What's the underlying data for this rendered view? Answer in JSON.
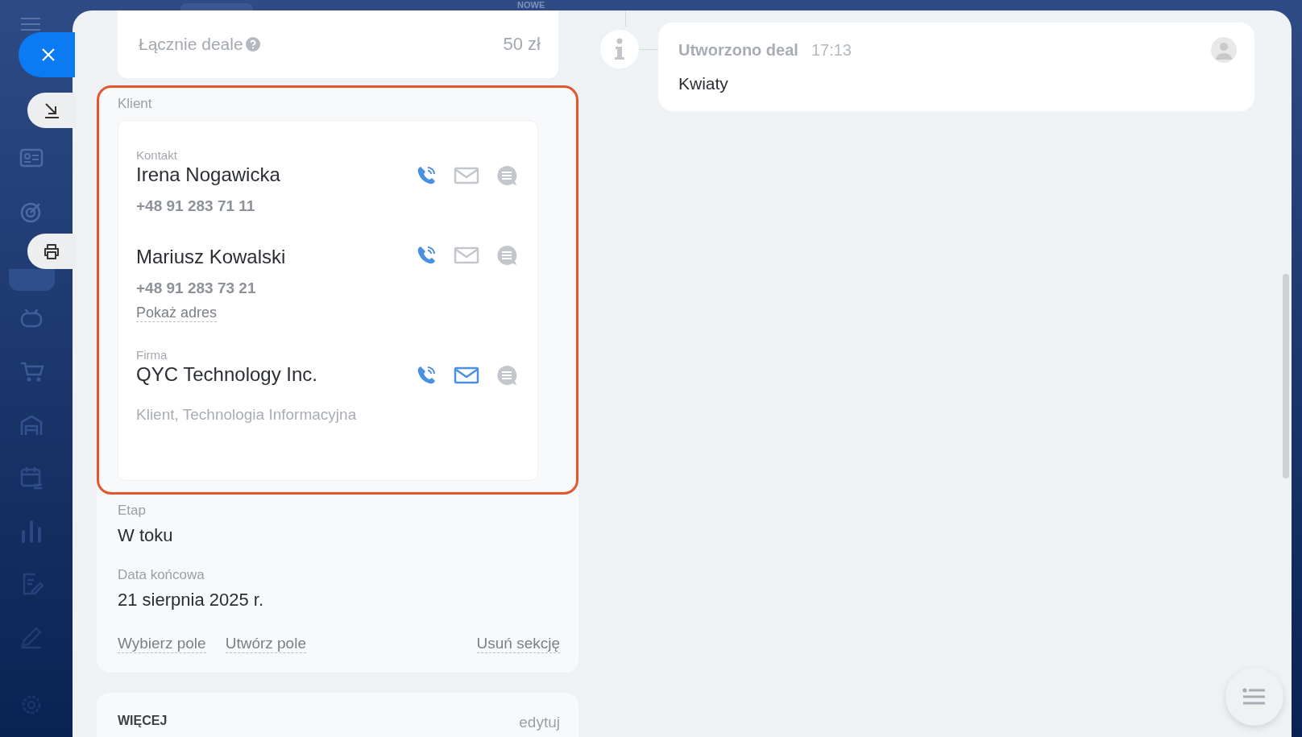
{
  "top_badge": "NOWE",
  "summary": {
    "label": "Łącznie deale",
    "value": "50 zł"
  },
  "client": {
    "title": "Klient",
    "highlighted": true,
    "contacts": [
      {
        "caption": "Kontakt",
        "name": "Irena Nogawicka",
        "phone": "+48 91 283 71 11",
        "email_active": false
      },
      {
        "name": "Mariusz Kowalski",
        "phone": "+48 91 283 73 21",
        "link": "Pokaż adres",
        "email_active": false
      },
      {
        "caption": "Firma",
        "name": "QYC Technology Inc.",
        "details": "Klient, Technologia Informacyjna",
        "email_active": true
      }
    ]
  },
  "fields": [
    {
      "label": "Etap",
      "value": "W toku"
    },
    {
      "label": "Data końcowa",
      "value": "21 sierpnia 2025 r."
    }
  ],
  "actions": [
    "Wybierz pole",
    "Utwórz pole"
  ],
  "remove_action": "Usuń sekcję",
  "more": {
    "title": "WIĘCEJ",
    "edit": "edytuj"
  },
  "timeline": [
    {
      "title": "Utworzono deal",
      "time": "17:13",
      "text": "Kwiaty"
    }
  ]
}
